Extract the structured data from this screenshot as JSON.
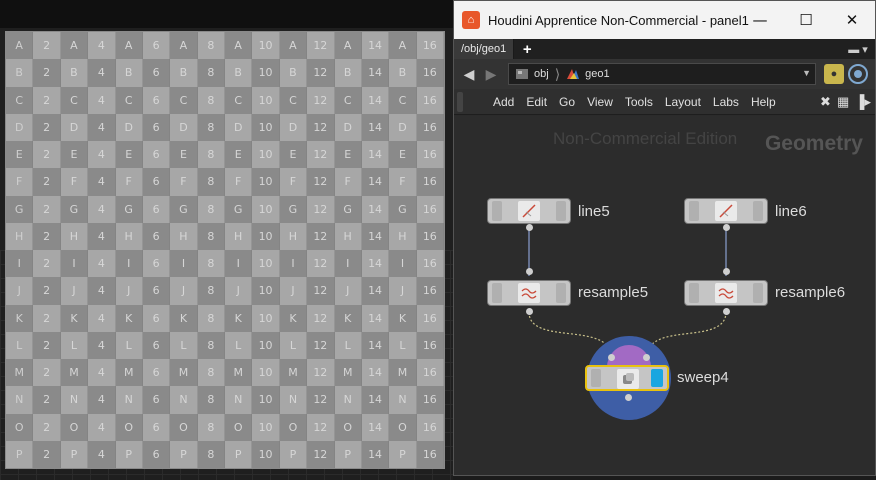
{
  "window": {
    "title": "Houdini Apprentice Non-Commercial - panel1",
    "app_icon": "houdini-logo-icon",
    "controls": {
      "minimize": "—",
      "maximize": "☐",
      "close": "✕"
    }
  },
  "tabs": [
    {
      "label": "/obj/geo1"
    }
  ],
  "tab_add": "+",
  "path": {
    "segments": [
      "obj",
      "geo1"
    ]
  },
  "menu": [
    "Add",
    "Edit",
    "Go",
    "View",
    "Tools",
    "Layout",
    "Labs",
    "Help"
  ],
  "network": {
    "watermark": "Non-Commercial Edition",
    "context_label": "Geometry",
    "nodes": [
      {
        "name": "line5",
        "icon": "line-sop-icon"
      },
      {
        "name": "line6",
        "icon": "line-sop-icon"
      },
      {
        "name": "resample5",
        "icon": "resample-sop-icon"
      },
      {
        "name": "resample6",
        "icon": "resample-sop-icon"
      },
      {
        "name": "sweep4",
        "icon": "sweep-sop-icon",
        "display_flag": true,
        "selected": true
      }
    ],
    "colors": {
      "display_flag": "#19a6e0",
      "selection": "#e8c10f",
      "sweep_ring": "#3e5ea6"
    }
  },
  "viewport": {
    "uv_rows": [
      "A",
      "B",
      "C",
      "D",
      "E",
      "F",
      "G",
      "H",
      "I",
      "J",
      "K",
      "L",
      "M",
      "N",
      "O",
      "P"
    ],
    "uv_cols": [
      "2",
      "A",
      "4",
      "A",
      "6",
      "A",
      "8",
      "A",
      "10",
      "A",
      "12",
      "A",
      "14",
      "A",
      "16"
    ]
  }
}
